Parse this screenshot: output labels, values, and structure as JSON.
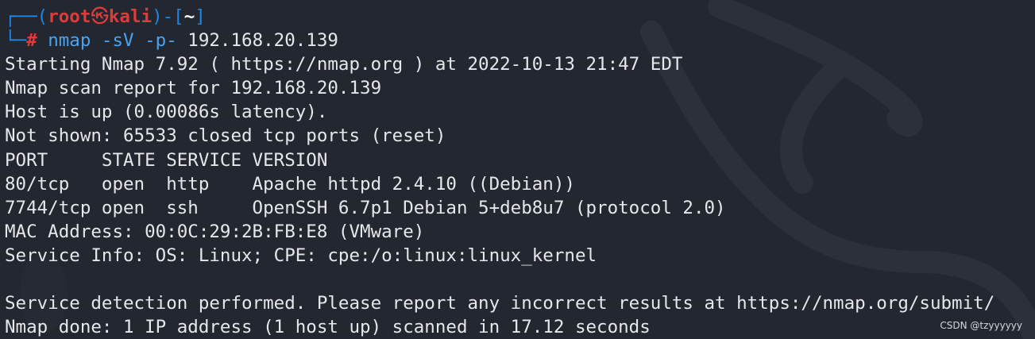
{
  "prompt": {
    "frame_left": "┌──(",
    "user": "root",
    "skull": "㉿",
    "host": "kali",
    "frame_mid": ")-[",
    "cwd": "~",
    "frame_right": "]",
    "frame_bottom": "└─",
    "hash": "#"
  },
  "command": {
    "name": "nmap",
    "flags": "-sV -p-",
    "target": "192.168.20.139"
  },
  "output": [
    "Starting Nmap 7.92 ( https://nmap.org ) at 2022-10-13 21:47 EDT",
    "Nmap scan report for 192.168.20.139",
    "Host is up (0.00086s latency).",
    "Not shown: 65533 closed tcp ports (reset)",
    "PORT     STATE SERVICE VERSION",
    "80/tcp   open  http    Apache httpd 2.4.10 ((Debian))",
    "7744/tcp open  ssh     OpenSSH 6.7p1 Debian 5+deb8u7 (protocol 2.0)",
    "MAC Address: 00:0C:29:2B:FB:E8 (VMware)",
    "Service Info: OS: Linux; CPE: cpe:/o:linux:linux_kernel",
    "",
    "Service detection performed. Please report any incorrect results at https://nmap.org/submit/",
    "Nmap done: 1 IP address (1 host up) scanned in 17.12 seconds"
  ],
  "watermark": "CSDN @tzyyyyyy",
  "colors": {
    "background": "#23272f",
    "prompt_frame": "#1f86e6",
    "prompt_user": "#e03b3b",
    "command": "#4aa3f0",
    "text": "#e6e7ea"
  }
}
